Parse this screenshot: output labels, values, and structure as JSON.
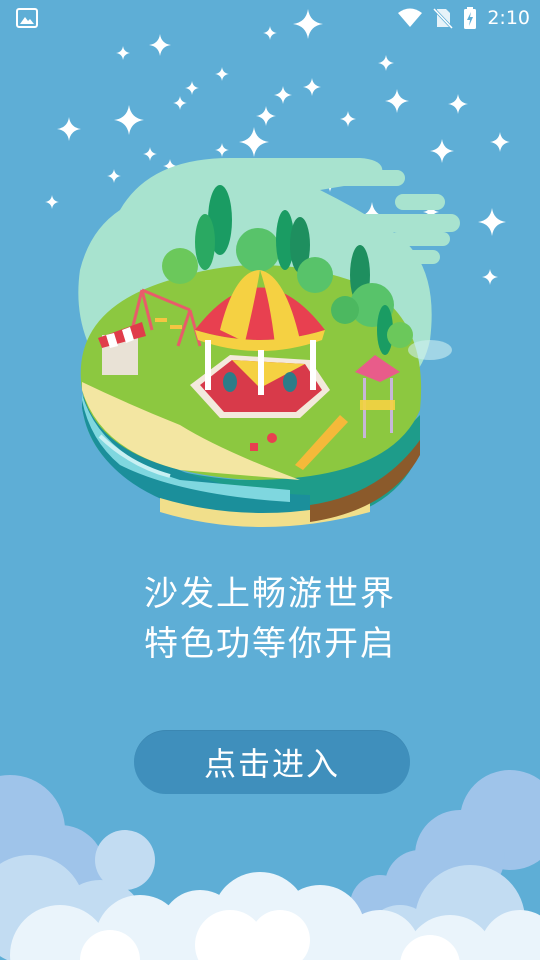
{
  "status_bar": {
    "time": "2:10",
    "icons": [
      "image-icon",
      "wifi-icon",
      "no-sim-icon",
      "battery-charging-icon"
    ]
  },
  "intro": {
    "line1": "沙发上畅游世界",
    "line2": "特色功等你开启"
  },
  "enter_button": {
    "label": "点击进入"
  },
  "colors": {
    "background": "#5eaed6",
    "button": "#3f8fbc",
    "text": "#ffffff"
  }
}
